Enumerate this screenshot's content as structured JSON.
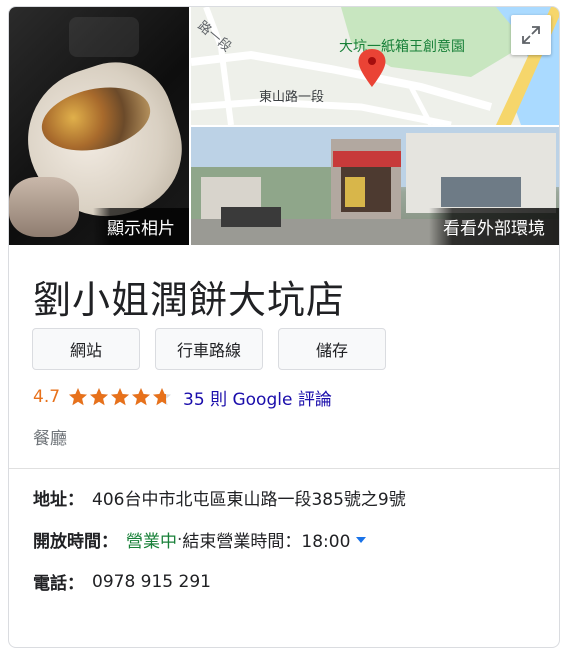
{
  "photos": {
    "main_label": "顯示相片",
    "street_label": "看看外部環境"
  },
  "map": {
    "road_labels": [
      "路一段",
      "東山路一段"
    ],
    "place_label": "大坑一紙箱王創意園",
    "marker_icon": "map-pin-icon",
    "expand_icon": "expand-icon",
    "colors": {
      "land": "#eef0ea",
      "park": "#c8e6c0",
      "water": "#aadaff",
      "highway": "#f6d66b",
      "pin": "#ea4335"
    }
  },
  "business": {
    "name": "劉小姐潤餅大坑店",
    "category": "餐廳"
  },
  "actions": [
    {
      "label": "網站"
    },
    {
      "label": "行車路線"
    },
    {
      "label": "儲存"
    }
  ],
  "rating": {
    "value": "4.7",
    "stars": 4.7,
    "max_stars": 5,
    "reviews_text": "35 則 Google 評論",
    "star_color": "#e7711b"
  },
  "details": {
    "address_label": "地址：",
    "address": "406台中市北屯區東山路一段385號之9號",
    "hours_label": "開放時間：",
    "hours_status": "營業中",
    "hours_sep": " · ",
    "hours_close": "結束營業時間：18:00",
    "phone_label": "電話：",
    "phone": "0978 915 291"
  }
}
